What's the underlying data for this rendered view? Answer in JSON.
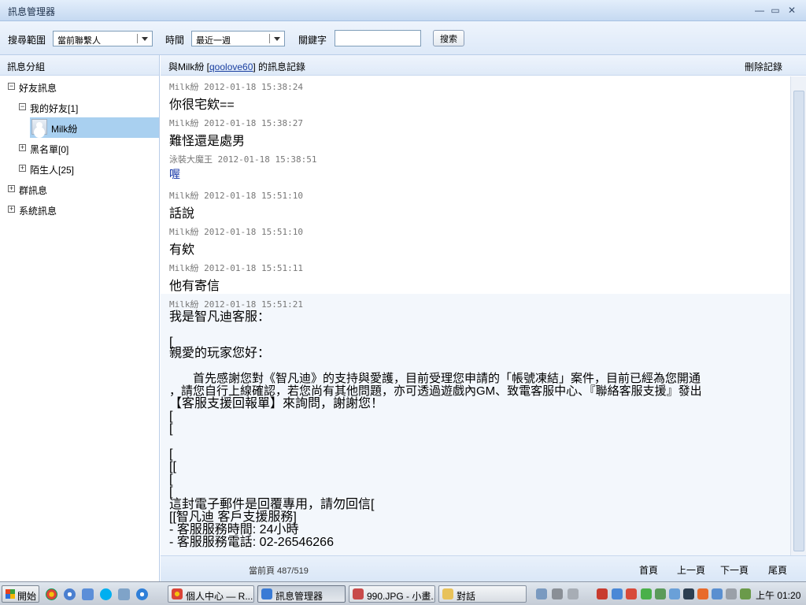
{
  "window": {
    "title": "訊息管理器",
    "minimize": "—",
    "restore": "▭",
    "close": "✕"
  },
  "toolbar": {
    "scope_label": "搜尋範圍",
    "scope_value": "當前聯繫人",
    "time_label": "時間",
    "time_value": "最近一週",
    "keyword_label": "關鍵字",
    "keyword_value": "",
    "search_button": "搜索"
  },
  "sidebar": {
    "header": "訊息分組",
    "tree": [
      {
        "label": "好友訊息",
        "toggle": "−"
      },
      {
        "label": "我的好友[1]",
        "toggle": "−"
      },
      {
        "label": "Milk紛",
        "selected": true
      },
      {
        "label": "黑名單[0]",
        "toggle": "+"
      },
      {
        "label": "陌生人[25]",
        "toggle": "+"
      },
      {
        "label": "群訊息",
        "toggle": "+"
      },
      {
        "label": "系統訊息",
        "toggle": "+"
      }
    ]
  },
  "chat": {
    "header_prefix": "與Milk紛 [",
    "header_link": "qoolove60",
    "header_suffix": "] 的訊息記錄",
    "delete_label": "刪除記錄",
    "messages": [
      {
        "sender": "Milk紛",
        "time": "2012-01-18 15:38:24",
        "text": "你很宅欸=="
      },
      {
        "sender": "Milk紛",
        "time": "2012-01-18 15:38:27",
        "text": "難怪還是處男"
      },
      {
        "sender": "泳裝大魔王",
        "time": "2012-01-18 15:38:51",
        "text": "喔"
      },
      {
        "sender": "Milk紛",
        "time": "2012-01-18 15:51:10",
        "text": "話說"
      },
      {
        "sender": "Milk紛",
        "time": "2012-01-18 15:51:10",
        "text": "有欸"
      },
      {
        "sender": "Milk紛",
        "time": "2012-01-18 15:51:11",
        "text": "他有寄信"
      },
      {
        "sender": "Milk紛",
        "time": "2012-01-18 15:51:21",
        "lines": [
          "我是智凡迪客服：",
          "",
          "[",
          "親愛的玩家您好：",
          "",
          "　　首先感謝您對《智凡迪》的支持與愛護，目前受理您申請的「帳號凍結」案件，目前已經為您開通",
          "，請您自行上線確認，若您尚有其他問題，亦可透過遊戲內GM、致電客服中心、『聯絡客服支援』發出",
          "【客服支援回報單】來詢問，謝謝您！",
          "[",
          "[",
          "",
          "[",
          "[[",
          "[",
          "[",
          "這封電子郵件是回覆專用，請勿回信[",
          "[[智凡迪 客戶支援服務]",
          "- 客服服務時間: 24小時",
          "- 客服服務電話: 02-26546266"
        ]
      }
    ]
  },
  "footer": {
    "page_info": "當前頁 487/519",
    "first": "首頁",
    "prev": "上一頁",
    "next": "下一頁",
    "last": "尾頁"
  },
  "taskbar": {
    "start": "開始",
    "tasks": [
      {
        "label": "個人中心 — R...",
        "color": "#e2a23a"
      },
      {
        "label": "訊息管理器",
        "color": "#3a7bd5",
        "active": true
      },
      {
        "label": "990.JPG - 小畫...",
        "color": "#c84a4a"
      },
      {
        "label": "對話",
        "color": "#e8c25a"
      }
    ],
    "clock": "上午 01:20"
  }
}
